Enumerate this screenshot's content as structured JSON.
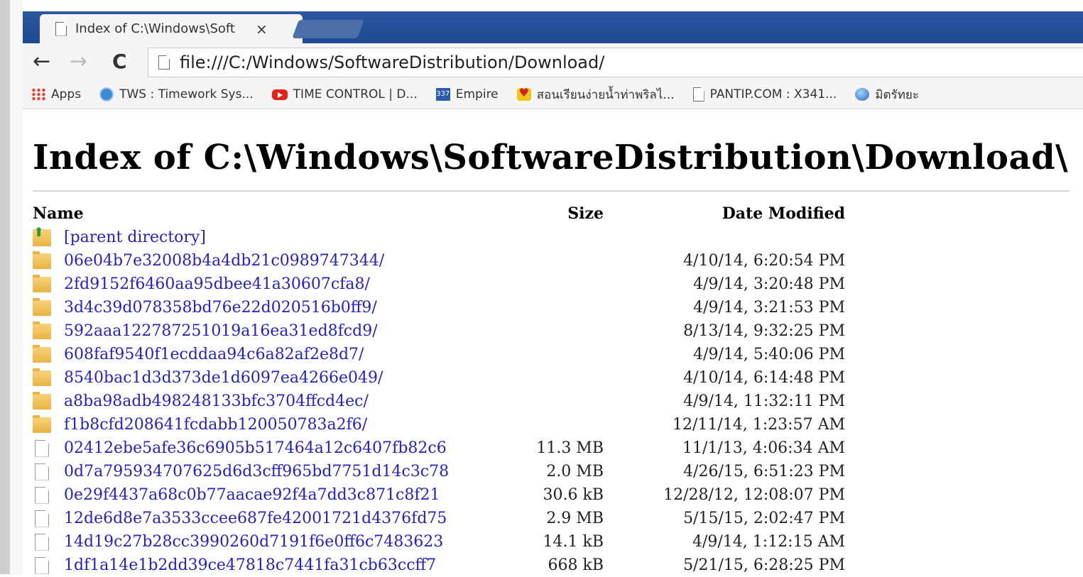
{
  "browser": {
    "tab_title": "Index of C:\\Windows\\Soft",
    "tab_close": "×",
    "url": "file:///C:/Windows/SoftwareDistribution/Download/",
    "nav": {
      "back": "←",
      "forward": "→",
      "reload": "C"
    },
    "bookmarks": [
      {
        "label": "Apps",
        "icon": "apps-grid-icon"
      },
      {
        "label": "TWS : Timework Sys...",
        "icon": "tws-globe-icon"
      },
      {
        "label": "TIME CONTROL | D...",
        "icon": "youtube-icon"
      },
      {
        "label": "Empire",
        "icon": "empire-icon"
      },
      {
        "label": "สอนเรียนง่ายน้ำท่าพริลไ...",
        "icon": "heart-badge-icon"
      },
      {
        "label": "PANTIP.COM : X341...",
        "icon": "page-icon"
      },
      {
        "label": "มิตรัทยะ",
        "icon": "globe-icon"
      }
    ]
  },
  "page": {
    "title": "Index of C:\\Windows\\SoftwareDistribution\\Download\\",
    "columns": {
      "name": "Name",
      "size": "Size",
      "date": "Date Modified"
    },
    "rows": [
      {
        "type": "parent",
        "name": "[parent directory]",
        "size": "",
        "date": ""
      },
      {
        "type": "folder",
        "name": "06e04b7e32008b4a4db21c0989747344/",
        "size": "",
        "date": "4/10/14, 6:20:54 PM"
      },
      {
        "type": "folder",
        "name": "2fd9152f6460aa95dbee41a30607cfa8/",
        "size": "",
        "date": "4/9/14, 3:20:48 PM"
      },
      {
        "type": "folder",
        "name": "3d4c39d078358bd76e22d020516b0ff9/",
        "size": "",
        "date": "4/9/14, 3:21:53 PM"
      },
      {
        "type": "folder",
        "name": "592aaa122787251019a16ea31ed8fcd9/",
        "size": "",
        "date": "8/13/14, 9:32:25 PM"
      },
      {
        "type": "folder",
        "name": "608faf9540f1ecddaa94c6a82af2e8d7/",
        "size": "",
        "date": "4/9/14, 5:40:06 PM"
      },
      {
        "type": "folder",
        "name": "8540bac1d3d373de1d6097ea4266e049/",
        "size": "",
        "date": "4/10/14, 6:14:48 PM"
      },
      {
        "type": "folder",
        "name": "a8ba98adb498248133bfc3704ffcd4ec/",
        "size": "",
        "date": "4/9/14, 11:32:11 PM"
      },
      {
        "type": "folder",
        "name": "f1b8cfd208641fcdabb120050783a2f6/",
        "size": "",
        "date": "12/11/14, 1:23:57 AM"
      },
      {
        "type": "file",
        "name": "02412ebe5afe36c6905b517464a12c6407fb82c6",
        "size": "11.3 MB",
        "date": "11/1/13, 4:06:34 AM"
      },
      {
        "type": "file",
        "name": "0d7a795934707625d6d3cff965bd7751d14c3c78",
        "size": "2.0 MB",
        "date": "4/26/15, 6:51:23 PM"
      },
      {
        "type": "file",
        "name": "0e29f4437a68c0b77aacae92f4a7dd3c871c8f21",
        "size": "30.6 kB",
        "date": "12/28/12, 12:08:07 PM"
      },
      {
        "type": "file",
        "name": "12de6d8e7a3533ccee687fe42001721d4376fd75",
        "size": "2.9 MB",
        "date": "5/15/15, 2:02:47 PM"
      },
      {
        "type": "file",
        "name": "14d19c27b28cc3990260d7191f6e0ff6c7483623",
        "size": "14.1 kB",
        "date": "4/9/14, 1:12:15 AM"
      },
      {
        "type": "file",
        "name": "1df1a14e1b2dd39ce47818c7441fa31cb63ccff7",
        "size": "668 kB",
        "date": "5/21/15, 6:28:25 PM"
      }
    ]
  }
}
